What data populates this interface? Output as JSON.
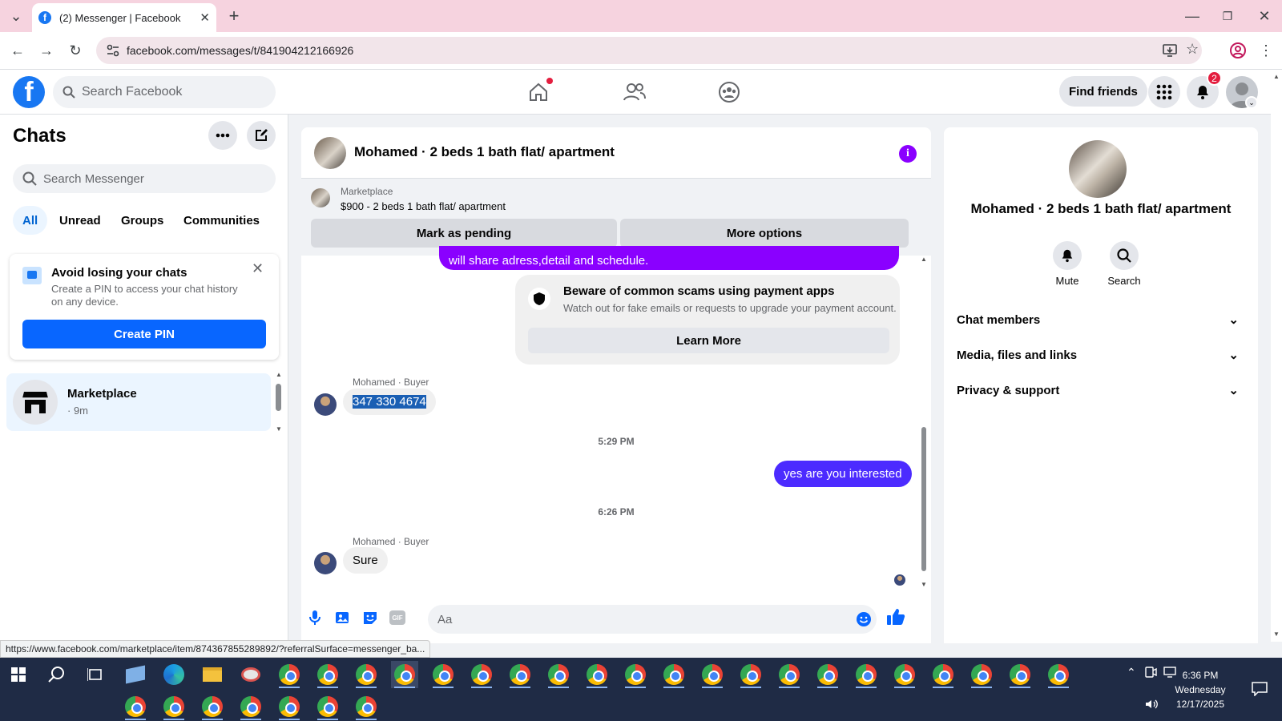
{
  "browser": {
    "tab_title": "(2) Messenger | Facebook",
    "url": "facebook.com/messages/t/841904212166926",
    "status_url": "https://www.facebook.com/marketplace/item/874367855289892/?referralSurface=messenger_ba..."
  },
  "header": {
    "search_placeholder": "Search Facebook",
    "find_friends": "Find friends",
    "notification_count": "2"
  },
  "left": {
    "title": "Chats",
    "search_placeholder": "Search Messenger",
    "filters": [
      "All",
      "Unread",
      "Groups",
      "Communities"
    ],
    "pin_card": {
      "title": "Avoid losing your chats",
      "body": "Create a PIN to access your chat history on any device.",
      "button": "Create PIN"
    },
    "chat_item": {
      "name": "Marketplace",
      "meta": "· 9m"
    }
  },
  "conversation": {
    "title": "Mohamed · 2 beds 1 bath flat/ apartment",
    "marketplace_label": "Marketplace",
    "listing": "$900 - 2 beds 1 bath flat/ apartment",
    "mark_pending": "Mark as pending",
    "more_options": "More options",
    "partial_message": "will share adress,detail and schedule.",
    "scam_title": "Beware of common scams using payment apps",
    "scam_body": "Watch out for fake emails or requests to upgrade your payment account.",
    "learn_more": "Learn More",
    "sender1": "Mohamed · Buyer",
    "msg_phone": "347 330 4674",
    "time1": "5:29 PM",
    "msg_out": "yes are you interested",
    "time2": "6:26 PM",
    "sender2": "Mohamed · Buyer",
    "msg_sure": "Sure",
    "input_placeholder": "Aa",
    "gif_label": "GIF"
  },
  "right": {
    "title": "Mohamed · 2 beds 1 bath flat/ apartment",
    "mute": "Mute",
    "search": "Search",
    "sections": [
      "Chat members",
      "Media, files and links",
      "Privacy & support"
    ]
  },
  "taskbar": {
    "time": "6:36 PM",
    "day": "Wednesday",
    "date": "12/17/2025"
  },
  "colors": {
    "fb_blue": "#1877f2",
    "outgoing_bubble": "#8a00ff",
    "badge_red": "#e41e3f"
  }
}
